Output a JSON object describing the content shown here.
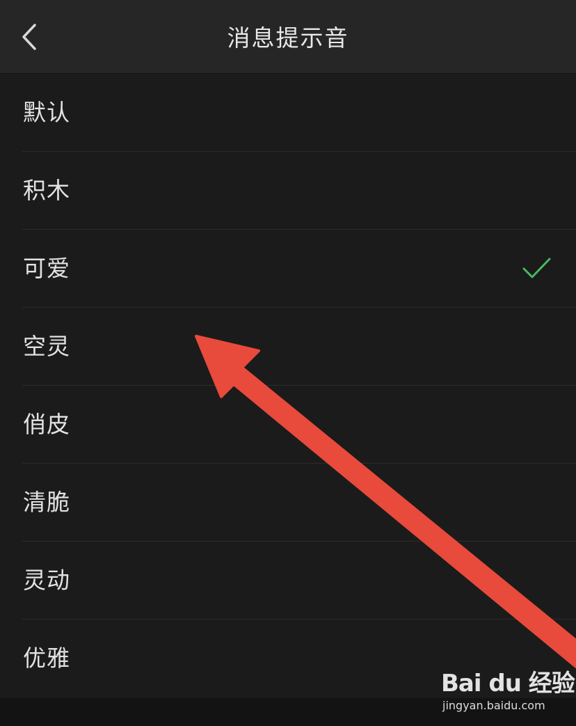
{
  "header": {
    "title": "消息提示音",
    "back_icon": "chevron-left-icon"
  },
  "sound_list": {
    "items": [
      {
        "label": "默认",
        "selected": false
      },
      {
        "label": "积木",
        "selected": false
      },
      {
        "label": "可爱",
        "selected": true
      },
      {
        "label": "空灵",
        "selected": false
      },
      {
        "label": "俏皮",
        "selected": false
      },
      {
        "label": "清脆",
        "selected": false
      },
      {
        "label": "灵动",
        "selected": false
      },
      {
        "label": "优雅",
        "selected": false
      }
    ],
    "check_icon": "checkmark-icon",
    "check_color": "#4ab85c"
  },
  "annotation": {
    "arrow_color": "#e84a3c"
  },
  "watermark": {
    "logo_text": "Bai du 经验",
    "url": "jingyan.baidu.com"
  },
  "colors": {
    "background": "#1b1b1b",
    "header": "#262626",
    "text": "#e2e2e2"
  }
}
